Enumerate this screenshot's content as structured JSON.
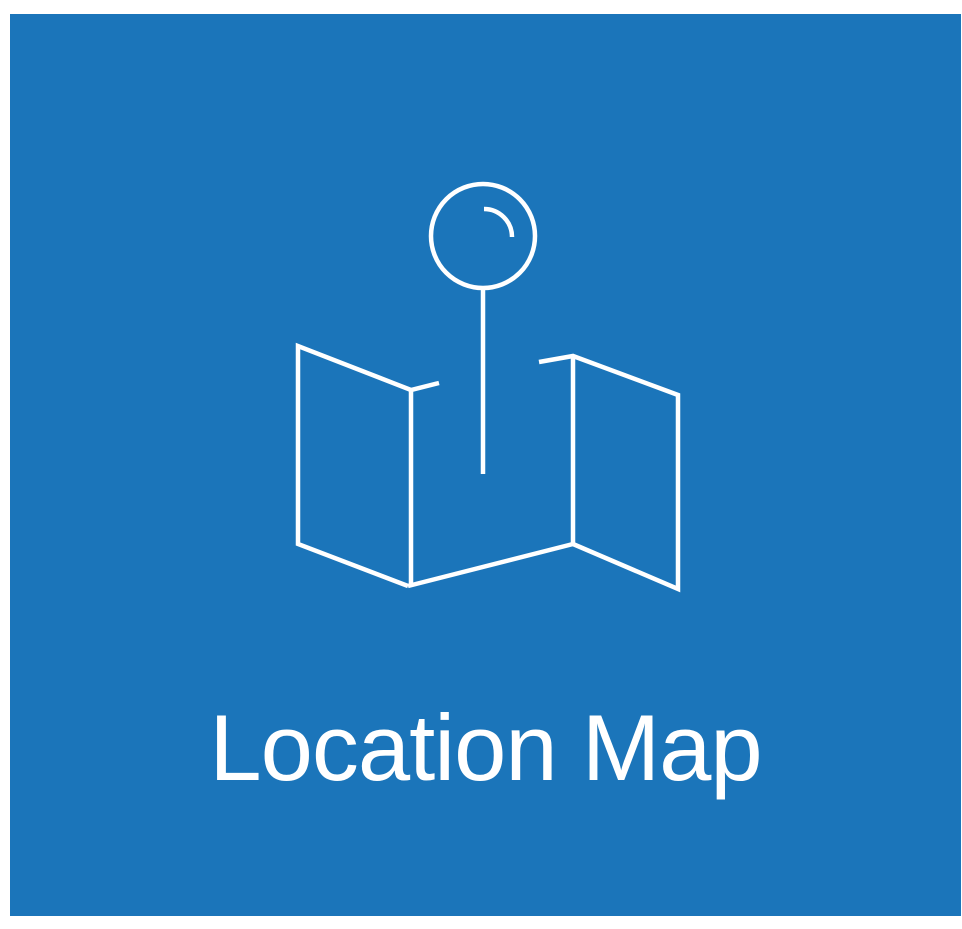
{
  "tile": {
    "label": "Location Map",
    "background_color": "#1b75ba",
    "foreground_color": "#ffffff",
    "icon": "map-pin-icon"
  }
}
